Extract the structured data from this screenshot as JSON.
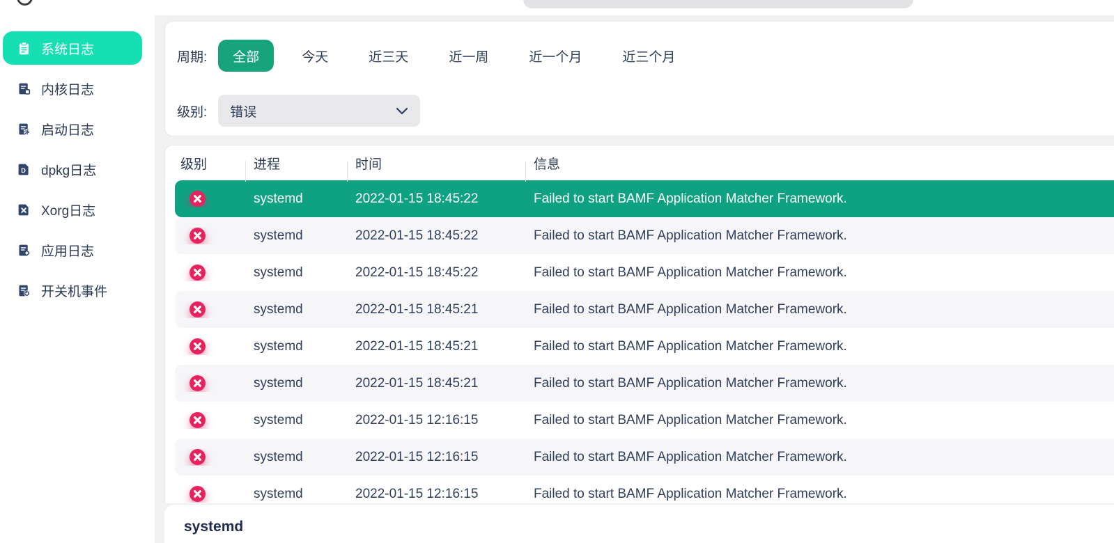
{
  "sidebar": {
    "items": [
      {
        "label": "系统日志",
        "icon": "system-log-icon",
        "selected": true
      },
      {
        "label": "内核日志",
        "icon": "kernel-log-icon",
        "selected": false
      },
      {
        "label": "启动日志",
        "icon": "boot-log-icon",
        "selected": false
      },
      {
        "label": "dpkg日志",
        "icon": "dpkg-log-icon",
        "selected": false
      },
      {
        "label": "Xorg日志",
        "icon": "xorg-log-icon",
        "selected": false
      },
      {
        "label": "应用日志",
        "icon": "app-log-icon",
        "selected": false
      },
      {
        "label": "开关机事件",
        "icon": "power-event-icon",
        "selected": false
      }
    ]
  },
  "filters": {
    "period_label": "周期:",
    "period_options": [
      {
        "label": "全部",
        "selected": true
      },
      {
        "label": "今天",
        "selected": false
      },
      {
        "label": "近三天",
        "selected": false
      },
      {
        "label": "近一周",
        "selected": false
      },
      {
        "label": "近一个月",
        "selected": false
      },
      {
        "label": "近三个月",
        "selected": false
      }
    ],
    "level_label": "级别:",
    "level_value": "错误"
  },
  "table": {
    "columns": [
      "级别",
      "进程",
      "时间",
      "信息"
    ],
    "rows": [
      {
        "level": "error",
        "process": "systemd",
        "time": "2022-01-15 18:45:22",
        "message": "Failed to start BAMF Application Matcher Framework.",
        "selected": true
      },
      {
        "level": "error",
        "process": "systemd",
        "time": "2022-01-15 18:45:22",
        "message": "Failed to start BAMF Application Matcher Framework.",
        "selected": false
      },
      {
        "level": "error",
        "process": "systemd",
        "time": "2022-01-15 18:45:22",
        "message": "Failed to start BAMF Application Matcher Framework.",
        "selected": false
      },
      {
        "level": "error",
        "process": "systemd",
        "time": "2022-01-15 18:45:21",
        "message": "Failed to start BAMF Application Matcher Framework.",
        "selected": false
      },
      {
        "level": "error",
        "process": "systemd",
        "time": "2022-01-15 18:45:21",
        "message": "Failed to start BAMF Application Matcher Framework.",
        "selected": false
      },
      {
        "level": "error",
        "process": "systemd",
        "time": "2022-01-15 18:45:21",
        "message": "Failed to start BAMF Application Matcher Framework.",
        "selected": false
      },
      {
        "level": "error",
        "process": "systemd",
        "time": "2022-01-15 12:16:15",
        "message": "Failed to start BAMF Application Matcher Framework.",
        "selected": false
      },
      {
        "level": "error",
        "process": "systemd",
        "time": "2022-01-15 12:16:15",
        "message": "Failed to start BAMF Application Matcher Framework.",
        "selected": false
      },
      {
        "level": "error",
        "process": "systemd",
        "time": "2022-01-15 12:16:15",
        "message": "Failed to start BAMF Application Matcher Framework.",
        "selected": false
      }
    ]
  },
  "detail": {
    "process_name": "systemd"
  },
  "icons": {
    "row_level_error": "error-x-circle-icon",
    "level_dropdown": "chevron-down-icon",
    "sidebar": [
      "system-log-icon",
      "kernel-log-icon",
      "boot-log-icon",
      "dpkg-log-icon",
      "xorg-log-icon",
      "app-log-icon",
      "power-event-icon"
    ]
  },
  "colors": {
    "sidebar_selected": "#16dfb4",
    "period_selected_button": "#17a47d",
    "row_selected": "#0ea283",
    "error_icon": "#e5235f",
    "text": "#2b3a55"
  }
}
